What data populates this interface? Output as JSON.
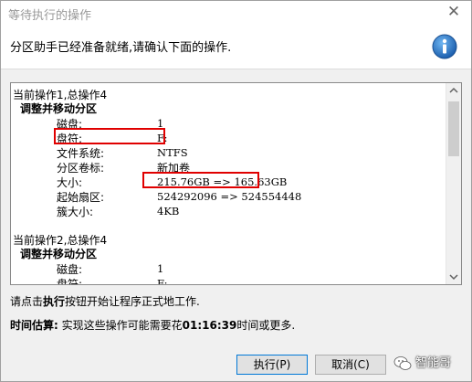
{
  "window": {
    "title": "等待执行的操作"
  },
  "banner": {
    "text": "分区助手已经准备就绪,请确认下面的操作."
  },
  "operations": [
    {
      "header": "当前操作1,总操作4",
      "title": "调整并移动分区",
      "fields": [
        {
          "label": "磁盘:",
          "value": "1"
        },
        {
          "label": "盘符:",
          "value": "F:"
        },
        {
          "label": "文件系统:",
          "value": "NTFS"
        },
        {
          "label": "分区卷标:",
          "value": "新加卷"
        },
        {
          "label": "大小:",
          "value": "215.76GB => 165.63GB"
        },
        {
          "label": "起始扇区:",
          "value": "524292096 => 524554448"
        },
        {
          "label": "簇大小:",
          "value": "4KB"
        }
      ]
    },
    {
      "header": "当前操作2,总操作4",
      "title": "调整并移动分区",
      "fields": [
        {
          "label": "磁盘:",
          "value": "1"
        },
        {
          "label": "盘符:",
          "value": "F:"
        }
      ]
    }
  ],
  "instruction": {
    "prefix": "请点击",
    "bold": "执行",
    "suffix": "按钮开始让程序正式地工作."
  },
  "estimate": {
    "label": "时间估算:",
    "text1": "实现这些操作可能需要花",
    "time": "01:16:39",
    "text2": "时间或更多."
  },
  "buttons": {
    "execute": "执行(P)",
    "cancel": "取消(C)"
  },
  "watermark": {
    "text": "智能哥"
  },
  "colors": {
    "highlight": "#e00000",
    "accent": "#0078d7",
    "info_icon": "#1c73c4"
  }
}
